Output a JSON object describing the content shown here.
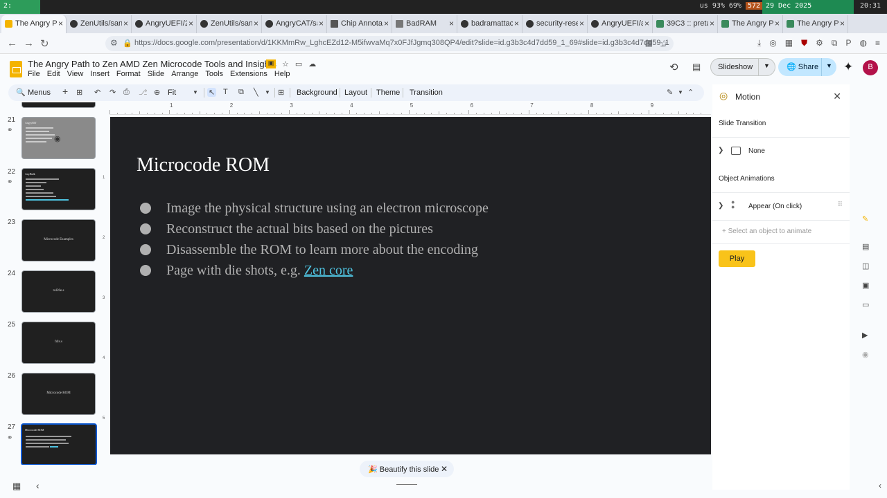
{
  "system": {
    "workspace": "2:",
    "tray": [
      "us",
      "93%",
      "69%",
      "572"
    ],
    "date": "29 Dec 2025",
    "time": "20:31"
  },
  "tabs": [
    {
      "label": "The Angry Pa"
    },
    {
      "label": "ZenUtils/san"
    },
    {
      "label": "AngryUEFI/2."
    },
    {
      "label": "ZenUtils/san"
    },
    {
      "label": "AngryCAT/sa"
    },
    {
      "label": "Chip Annotat"
    },
    {
      "label": "BadRAM"
    },
    {
      "label": "badramattac"
    },
    {
      "label": "security-rese"
    },
    {
      "label": "AngryUEFI/a"
    },
    {
      "label": "39C3 :: preta"
    },
    {
      "label": "The Angry Pa"
    },
    {
      "label": "The Angry Pa"
    }
  ],
  "address": {
    "url": "https://docs.google.com/presentation/d/1KKMmRw_LghcEZd12-M5ifwvaMq7x0FJfJgmq308QP4/edit?slide=id.g3b3c4d7dd59_1_69#slide=id.g3b3c4d7dd59_1"
  },
  "doc": {
    "title": "The Angry Path to Zen AMD Zen Microcode Tools and Insights",
    "menus": [
      "File",
      "Edit",
      "View",
      "Insert",
      "Format",
      "Slide",
      "Arrange",
      "Tools",
      "Extensions",
      "Help"
    ]
  },
  "header": {
    "slideshow_label": "Slideshow",
    "share_label": "Share",
    "avatar": "B"
  },
  "toolbar": {
    "menus_label": "Menus",
    "zoom": "Fit",
    "background": "Background",
    "layout": "Layout",
    "theme": "Theme",
    "transition": "Transition"
  },
  "filmstrip": [
    {
      "num": "21",
      "title": "AngryBIT",
      "center": "",
      "hidden": true,
      "active": false
    },
    {
      "num": "22",
      "title": "AnyBulk",
      "center": "",
      "hidden": false,
      "active": false
    },
    {
      "num": "23",
      "title": "",
      "center": "Microcode Examples",
      "hidden": false,
      "active": false
    },
    {
      "num": "24",
      "title": "",
      "center": "rol20e.s",
      "hidden": false,
      "active": false
    },
    {
      "num": "25",
      "title": "",
      "center": "fdiv.s",
      "hidden": false,
      "active": false
    },
    {
      "num": "26",
      "title": "",
      "center": "Microcode ROM",
      "hidden": false,
      "active": false
    },
    {
      "num": "27",
      "title": "Microcode ROM",
      "center": "",
      "hidden": false,
      "active": true
    }
  ],
  "ruler": [
    "1",
    "2",
    "3",
    "4",
    "5",
    "6",
    "7",
    "8",
    "9"
  ],
  "vruler": [
    "1",
    "2",
    "3",
    "4",
    "5"
  ],
  "slide": {
    "title": "Microcode ROM",
    "bullets": [
      {
        "text": "Image the physical structure using an electron microscope",
        "link": ""
      },
      {
        "text": "Reconstruct the actual bits based on the pictures",
        "link": ""
      },
      {
        "text": "Disassemble the ROM to learn more about the encoding",
        "link": ""
      },
      {
        "text": "Page with die shots, e.g. ",
        "link": "Zen core"
      }
    ]
  },
  "beautify_label": "Beautify this slide",
  "motion": {
    "title": "Motion",
    "slide_transition_heading": "Slide Transition",
    "transition_value": "None",
    "object_animations_heading": "Object Animations",
    "animation_label": "Appear  (On click)",
    "add_placeholder": "+ Select an object to animate",
    "play_label": "Play"
  },
  "colors": {
    "accent": "#0b57d0",
    "play": "#f9c31a",
    "link": "#4fc3e0",
    "slide_bg": "#202124"
  }
}
